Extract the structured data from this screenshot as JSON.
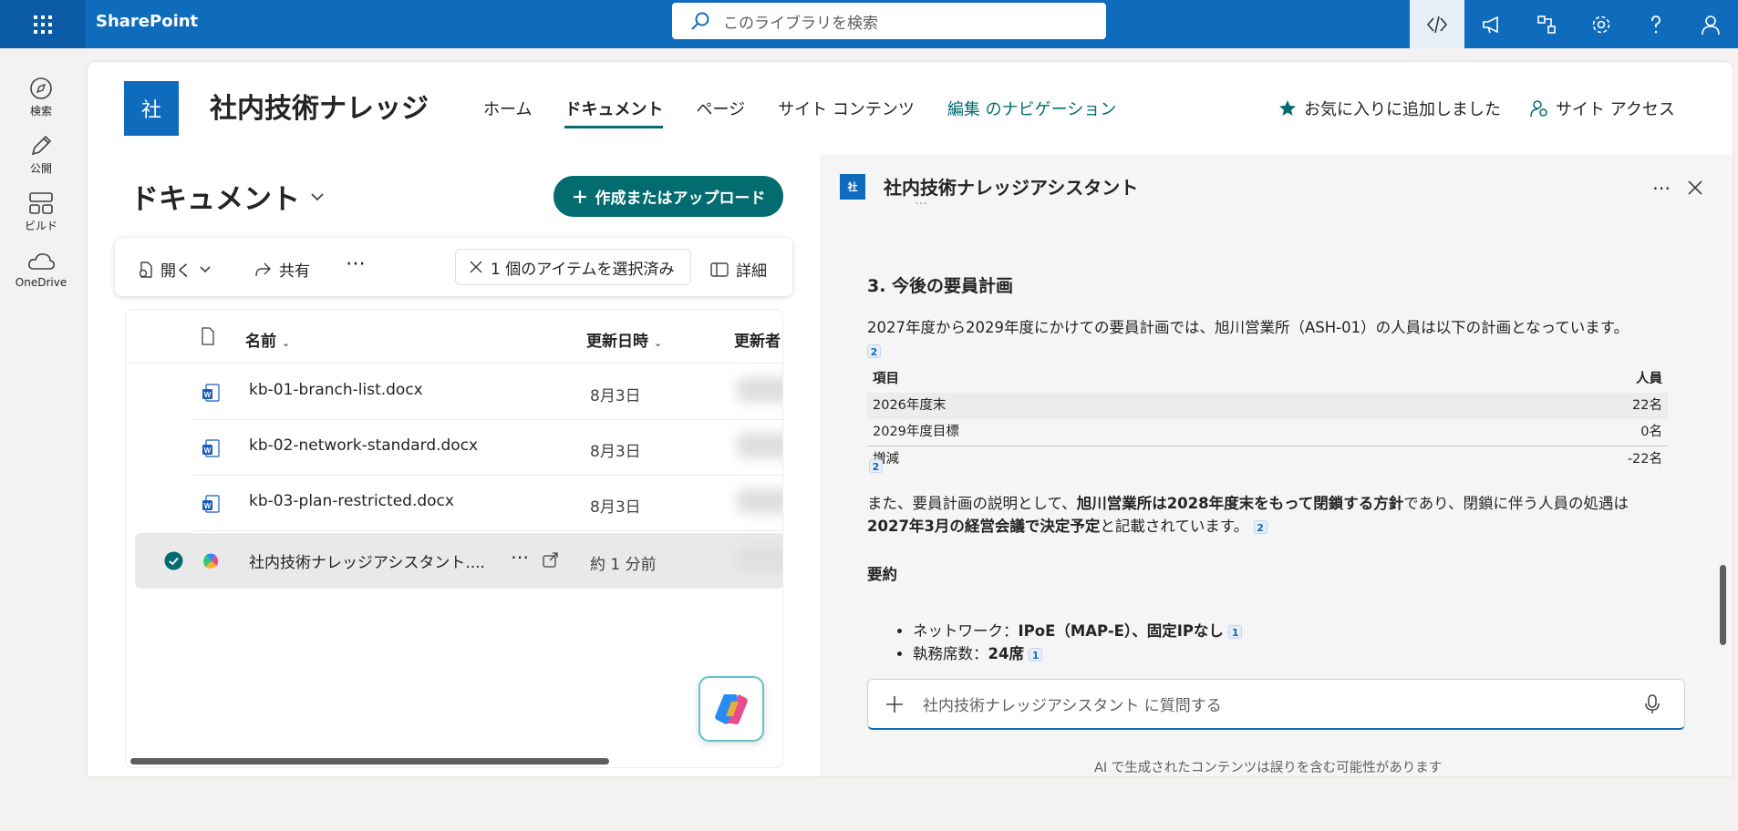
{
  "topbar": {
    "brand": "SharePoint",
    "search_placeholder": "このライブラリを検索"
  },
  "leftrail": {
    "items": [
      {
        "label": "検索"
      },
      {
        "label": "公開"
      },
      {
        "label": "ビルド"
      },
      {
        "label": "OneDrive"
      }
    ]
  },
  "site": {
    "logo_letter": "社",
    "title": "社内技術ナレッジ",
    "nav": [
      "ホーム",
      "ドキュメント",
      "ページ",
      "サイト コンテンツ",
      "編集 のナビゲーション"
    ],
    "favorite": "お気に入りに追加しました",
    "access": "サイト アクセス"
  },
  "library": {
    "title": "ドキュメント",
    "create_button": "作成またはアップロード",
    "cmd_open": "開く",
    "cmd_share": "共有",
    "selection": "1 個のアイテムを選択済み",
    "details": "詳細",
    "columns": {
      "name": "名前",
      "modified": "更新日時",
      "modified_by": "更新者"
    },
    "rows": [
      {
        "name": "kb-01-branch-list.docx",
        "modified": "8月3日"
      },
      {
        "name": "kb-02-network-standard.docx",
        "modified": "8月3日"
      },
      {
        "name": "kb-03-plan-restricted.docx",
        "modified": "8月3日"
      },
      {
        "name": "社内技術ナレッジアシスタント....",
        "modified": "約 1 分前"
      }
    ]
  },
  "assistant": {
    "logo_letter": "社",
    "title": "社内技術ナレッジアシスタント",
    "section_heading": "3. 今後の要員計画",
    "intro": "2027年度から2029年度にかけての要員計画では、旭川営業所（ASH-01）の人員は以下の計画となっています。",
    "cite_2": "2",
    "cite_1": "1",
    "table": {
      "col_item": "項目",
      "col_people": "人員",
      "rows": [
        {
          "item": "2026年度末",
          "people": "22名"
        },
        {
          "item": "2029年度目標",
          "people": "0名"
        },
        {
          "item": "増減",
          "people": "-22名"
        }
      ]
    },
    "para2_a": "また、要員計画の説明として、",
    "para2_b": "旭川営業所は2028年度末をもって閉鎖する方針",
    "para2_c": "であり、閉鎖に伴う人員の処遇は",
    "para2_d": "2027年3月の経営会議で決定予定",
    "para2_e": "と記載されています。",
    "summary_heading": "要約",
    "summary": [
      {
        "label": "ネットワーク：",
        "value": "IPoE（MAP-E）、固定IPなし"
      },
      {
        "label": "執務席数：",
        "value": "24席"
      }
    ],
    "ask_placeholder": "社内技術ナレッジアシスタント に質問する",
    "disclaimer": "AI で生成されたコンテンツは誤りを含む可能性があります"
  },
  "colors": {
    "brand_blue": "#0f6cbd",
    "teal": "#036c70"
  }
}
